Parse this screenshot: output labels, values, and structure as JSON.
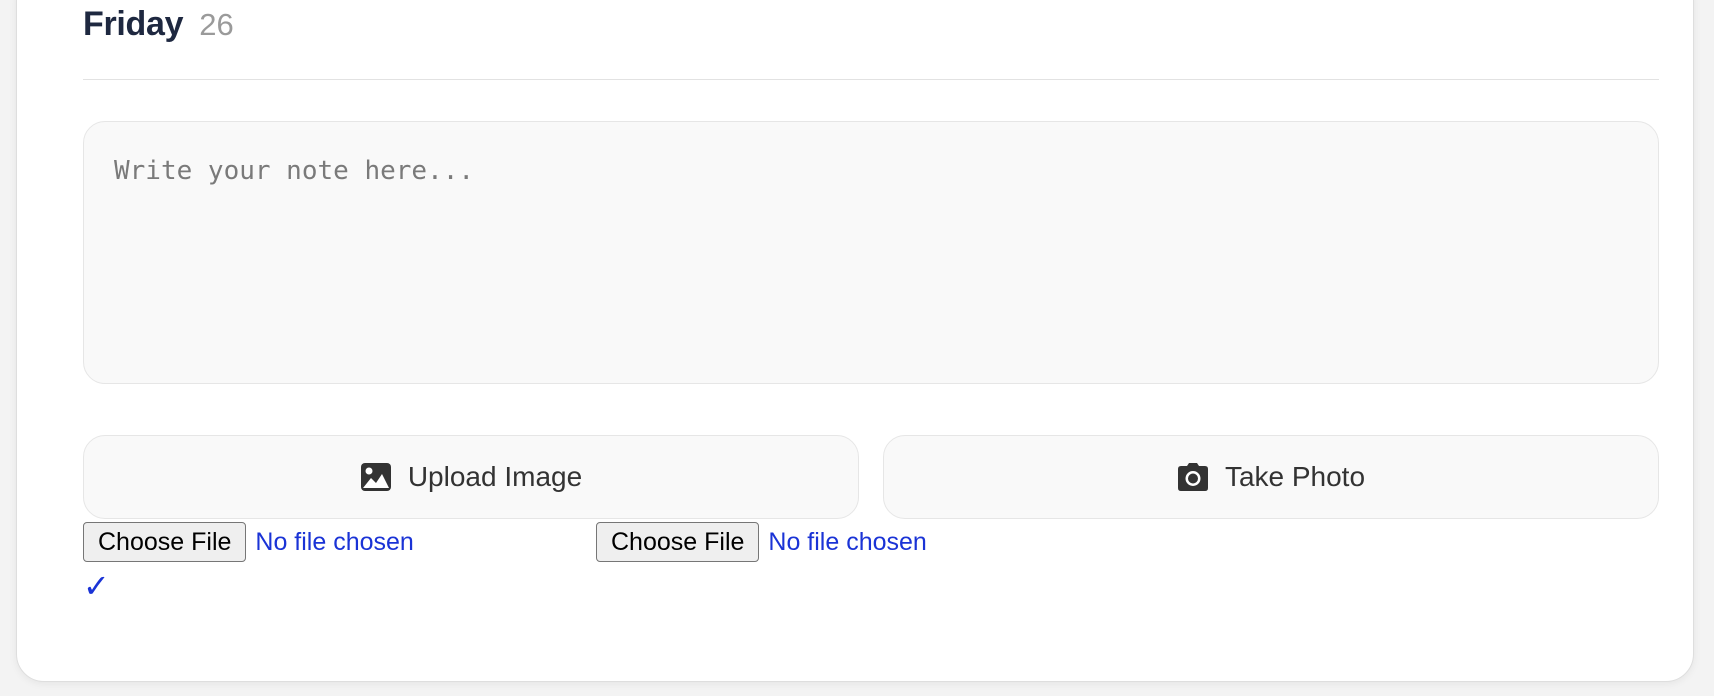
{
  "header": {
    "day_name": "Friday",
    "day_number": "26"
  },
  "note": {
    "placeholder": "Write your note here...",
    "value": ""
  },
  "actions": {
    "upload_label": "Upload Image",
    "upload_icon": "image-icon",
    "photo_label": "Take Photo",
    "photo_icon": "camera-icon"
  },
  "file_inputs": [
    {
      "button_label": "Choose File",
      "status": "No file chosen"
    },
    {
      "button_label": "Choose File",
      "status": "No file chosen"
    }
  ],
  "status": {
    "checkmark": "✓"
  },
  "colors": {
    "title": "#1e2840",
    "muted": "#9a9a9a",
    "link_blue": "#1a33d6"
  }
}
